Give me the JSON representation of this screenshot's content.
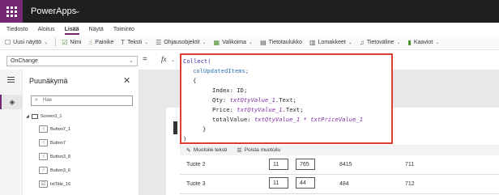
{
  "app": {
    "title": "PowerApps",
    "title_caret": "⌄"
  },
  "tabs": [
    "Tiedosto",
    "Aloitus",
    "Lisää",
    "Näytä",
    "Toiminto"
  ],
  "active_tab": "Lisää",
  "toolbar": [
    {
      "icon": "☐",
      "label": "Uusi näyttö",
      "caret": true
    },
    {
      "icon": "☑",
      "label": "Nimi",
      "caret": false
    },
    {
      "icon": "☝",
      "label": "Painike",
      "caret": false
    },
    {
      "icon": "T",
      "label": "Teksti",
      "caret": true
    },
    {
      "icon": "☰",
      "label": "Ohjausobjektit",
      "caret": true
    },
    {
      "icon": "▦",
      "label": "Valikoima",
      "caret": true
    },
    {
      "icon": "▤",
      "label": "Tietotaulukko",
      "caret": false
    },
    {
      "icon": "▥",
      "label": "Lomakkeet",
      "caret": true
    },
    {
      "icon": "♫",
      "label": "Tietoväline",
      "caret": true
    },
    {
      "icon": "▮",
      "label": "Kaaviot",
      "caret": true
    }
  ],
  "formula": {
    "property": "OnChange",
    "equals": "=",
    "fx": "fx"
  },
  "tree_panel": {
    "title": "Puunäkymä",
    "search_placeholder": "Hae",
    "items": [
      "Screen3_1",
      "Button7_1",
      "Button7",
      "Button3_8",
      "Button3_6",
      "txtTitle_16"
    ]
  },
  "code": {
    "l1": "Collect(",
    "l2": "colUpdatedItems;",
    "l3": "{",
    "l4_key": "Index:",
    "l4_val": "ID;",
    "l5_key": "Qty:",
    "l5_ctrl": "txtQtyValue_1",
    "l5_end": ".Text;",
    "l6_key": "Price:",
    "l6_ctrl": "txtQtyValue_1",
    "l6_end": ".Text;",
    "l7_key": "totalValue:",
    "l7_expr": "txtQtyValue_1 * txtPriceValue_1",
    "l8": "}",
    "l9": ")"
  },
  "format_bar": {
    "format_text": "Muotoile teksti",
    "remove_format": "Poista muotoilu"
  },
  "gallery_rows": [
    {
      "name": "Tuote 2",
      "qty": "11",
      "price": "765",
      "total": "8415",
      "extra": "711"
    },
    {
      "name": "Tuote 3",
      "qty": "11",
      "price": "44",
      "total": "484",
      "extra": "712"
    }
  ]
}
